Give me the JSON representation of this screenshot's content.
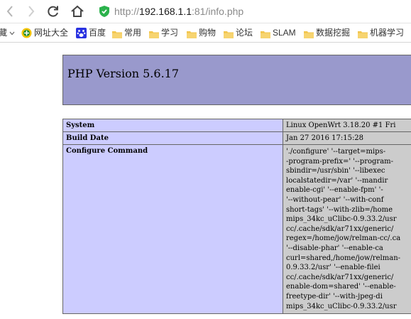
{
  "browser": {
    "url_scheme": "http://",
    "url_host": "192.168.1.1",
    "url_rest": ":81/info.php"
  },
  "bookmarks": [
    {
      "label": "藏",
      "icon": "chevron-down-icon"
    },
    {
      "label": "网址大全",
      "icon": "url-directory-icon"
    },
    {
      "label": "百度",
      "icon": "baidu-paw-icon"
    },
    {
      "label": "常用",
      "icon": "folder-icon"
    },
    {
      "label": "学习",
      "icon": "folder-icon"
    },
    {
      "label": "购物",
      "icon": "folder-icon"
    },
    {
      "label": "论坛",
      "icon": "folder-icon"
    },
    {
      "label": "SLAM",
      "icon": "folder-icon"
    },
    {
      "label": "数据挖掘",
      "icon": "folder-icon"
    },
    {
      "label": "机器学习",
      "icon": "folder-icon"
    }
  ],
  "php": {
    "title": "PHP Version 5.6.17",
    "rows": [
      {
        "key": "System",
        "value": "Linux OpenWrt 3.18.20 #1 Fri"
      },
      {
        "key": "Build Date",
        "value": "Jan 27 2016 17:15:28"
      },
      {
        "key": "Configure Command",
        "value_lines": [
          "'./configure' '--target=mips-",
          "-program-prefix=' '--program-",
          "sbindir=/usr/sbin' '--libexec",
          "localstatedir=/var' '--mandir",
          "enable-cgi' '--enable-fpm' '-",
          "'--without-pear' '--with-conf",
          "short-tags' '--with-zlib=/home",
          "mips_34kc_uClibc-0.9.33.2/usr",
          "cc/.cache/sdk/ar71xx/generic/",
          "regex=/home/jow/relman-cc/.ca",
          "'--disable-phar' '--enable-ca",
          "curl=shared,/home/jow/relman-",
          "0.9.33.2/usr' '--enable-filei",
          "cc/.cache/sdk/ar71xx/generic/",
          "enable-dom=shared' '--enable-",
          "freetype-dir' '--with-jpeg-di",
          "mips_34kc_uClibc-0.9.33.2/usr"
        ]
      }
    ]
  },
  "colors": {
    "header_bg": "#9999cc",
    "key_bg": "#ccccff",
    "value_bg": "#cccccc",
    "shield_green": "#2bb24c",
    "folder_yellow": "#f2c54b"
  }
}
